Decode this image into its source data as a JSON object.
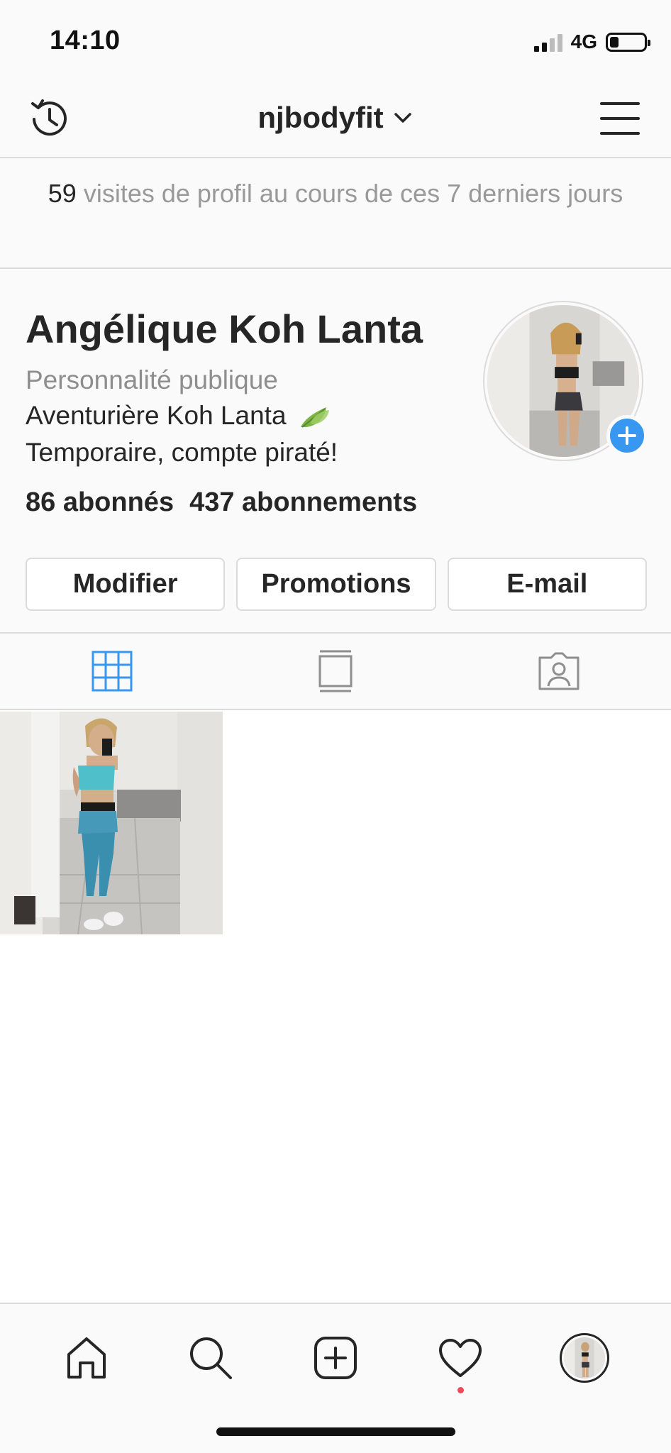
{
  "status_bar": {
    "time": "14:10",
    "network": "4G",
    "battery_level": 0.3
  },
  "header": {
    "username": "njbodyfit",
    "icons": {
      "left": "history-icon",
      "username_dropdown": "chevron-down-icon",
      "right": "menu-icon"
    }
  },
  "visits": {
    "count": "59",
    "text": " visites de profil au cours de ces 7 derniers jours"
  },
  "profile": {
    "display_name": "Angélique Koh Lanta",
    "category": "Personnalité publique",
    "bio_line_1": "Aventurière Koh Lanta",
    "bio_emoji": "leaf-icon",
    "bio_line_2": "Temporaire, compte piraté!",
    "followers": "86 abonnés",
    "following": "437 abonnements"
  },
  "actions": {
    "edit": "Modifier",
    "promotions": "Promotions",
    "email": "E-mail"
  },
  "tabs": [
    {
      "icon": "grid-icon",
      "active": true
    },
    {
      "icon": "igtv-icon",
      "active": false
    },
    {
      "icon": "tagged-icon",
      "active": false
    }
  ],
  "bottom_nav": [
    {
      "icon": "home-icon"
    },
    {
      "icon": "search-icon"
    },
    {
      "icon": "new-post-icon"
    },
    {
      "icon": "activity-heart-icon",
      "has_notification": true
    },
    {
      "icon": "profile-avatar-icon"
    }
  ],
  "colors": {
    "accent": "#3897f0",
    "text": "#262626",
    "muted": "#8e8e8e",
    "notification": "#ed4956"
  }
}
